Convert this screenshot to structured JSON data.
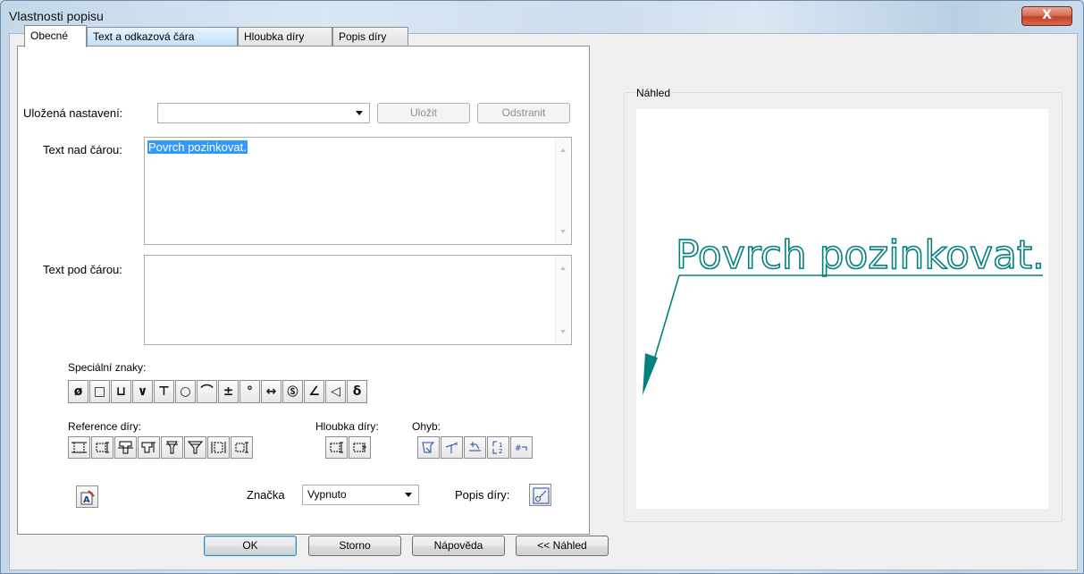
{
  "window": {
    "title": "Vlastnosti popisu",
    "close_glyph": "X"
  },
  "tabs": [
    {
      "label": "Obecné",
      "active": true
    },
    {
      "label": "Text a odkazová čára",
      "active": false
    },
    {
      "label": "Hloubka díry",
      "active": false
    },
    {
      "label": "Popis díry",
      "active": false
    }
  ],
  "saved_settings": {
    "label": "Uložená nastavení:",
    "value": "",
    "save_label": "Uložit",
    "delete_label": "Odstranit"
  },
  "text_above": {
    "label": "Text nad čárou:",
    "value": "Povrch pozinkovat."
  },
  "text_below": {
    "label": "Text pod čárou:",
    "value": ""
  },
  "special_chars": {
    "label": "Speciální znaky:",
    "symbols": [
      "ø",
      "□",
      "⊔",
      "∨",
      "⊤",
      "○",
      "⌒",
      "±",
      "°",
      "↔",
      "Ⓢ",
      "∠",
      "◁",
      "δ"
    ]
  },
  "hole_reference": {
    "label": "Reference díry:",
    "icons": [
      "hole-ref-1-icon",
      "hole-ref-2-icon",
      "hole-ref-3-icon",
      "hole-ref-4-icon",
      "hole-ref-5-icon",
      "hole-ref-6-icon",
      "hole-ref-7-icon",
      "hole-ref-8-icon"
    ]
  },
  "hole_depth": {
    "label": "Hloubka díry:",
    "icons": [
      "hole-depth-1-icon",
      "hole-depth-2-icon"
    ]
  },
  "bend": {
    "label": "Ohyb:",
    "icons": [
      "bend-1-icon",
      "bend-2-icon",
      "bend-3-icon",
      "bend-4-icon",
      "bend-5-icon"
    ]
  },
  "marker": {
    "label": "Značka",
    "value": "Vypnuto"
  },
  "hole_callout": {
    "label": "Popis díry:"
  },
  "buttons": {
    "ok": "OK",
    "cancel": "Storno",
    "help": "Nápověda",
    "preview": "<< Náhled"
  },
  "preview": {
    "title": "Náhled",
    "text": "Povrch pozinkovat.",
    "color": "#00807f"
  }
}
